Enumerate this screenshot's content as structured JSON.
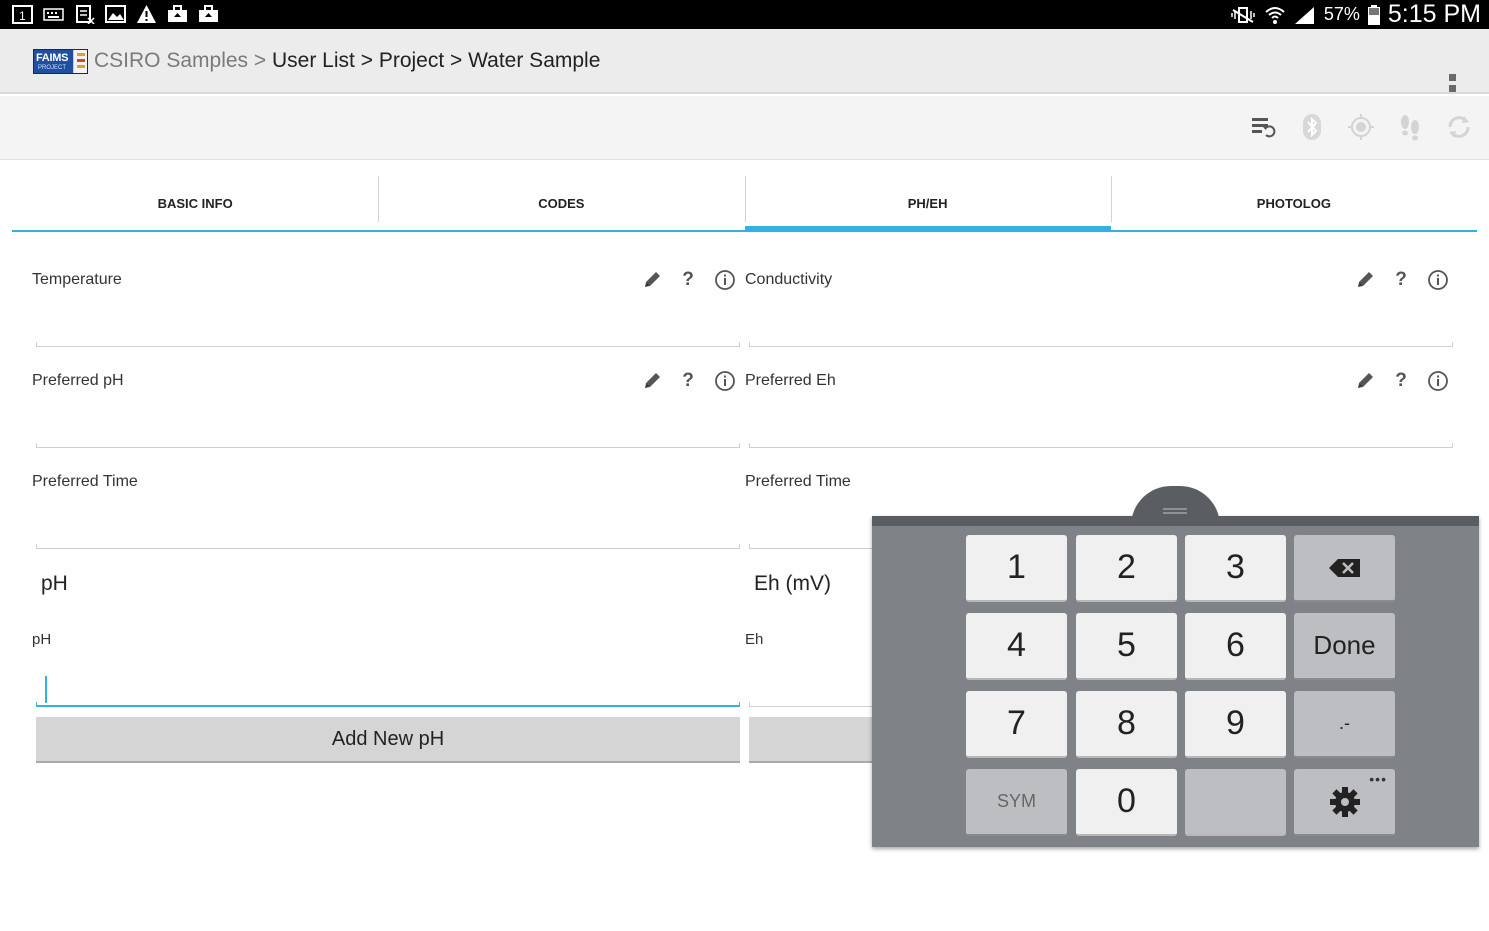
{
  "status_bar": {
    "battery": "57%",
    "time": "5:15 PM"
  },
  "breadcrumb": {
    "logo": "FAIMS",
    "logo_sub": "PROJECT",
    "root": "CSIRO Samples",
    "sep1": ">",
    "item1": "User List",
    "sep2": ">",
    "item2": "Project",
    "sep3": ">",
    "item3": "Water Sample"
  },
  "tabs": [
    "BASIC INFO",
    "CODES",
    "PH/EH",
    "PHOTOLOG"
  ],
  "active_tab": "PH/EH",
  "fields": {
    "temperature": "Temperature",
    "conductivity": "Conductivity",
    "preferred_ph": "Preferred pH",
    "preferred_eh": "Preferred Eh",
    "preferred_time_left": "Preferred Time",
    "preferred_time_right": "Preferred Time",
    "ph_heading": "pH",
    "eh_heading": "Eh (mV)",
    "ph_label": "pH",
    "eh_label": "Eh"
  },
  "field_icons": {
    "question": "?",
    "info": "i"
  },
  "buttons": {
    "add_ph": "Add New pH"
  },
  "keyboard": {
    "keys": [
      "1",
      "2",
      "3",
      "4",
      "5",
      "6",
      "7",
      "8",
      "9",
      "0"
    ],
    "done": "Done",
    "punct": ".-",
    "sym": "SYM",
    "more": "•••"
  },
  "colors": {
    "accent": "#36b0e3",
    "keyboard_bg": "#7f8287",
    "brand": "#1f4f9e"
  }
}
